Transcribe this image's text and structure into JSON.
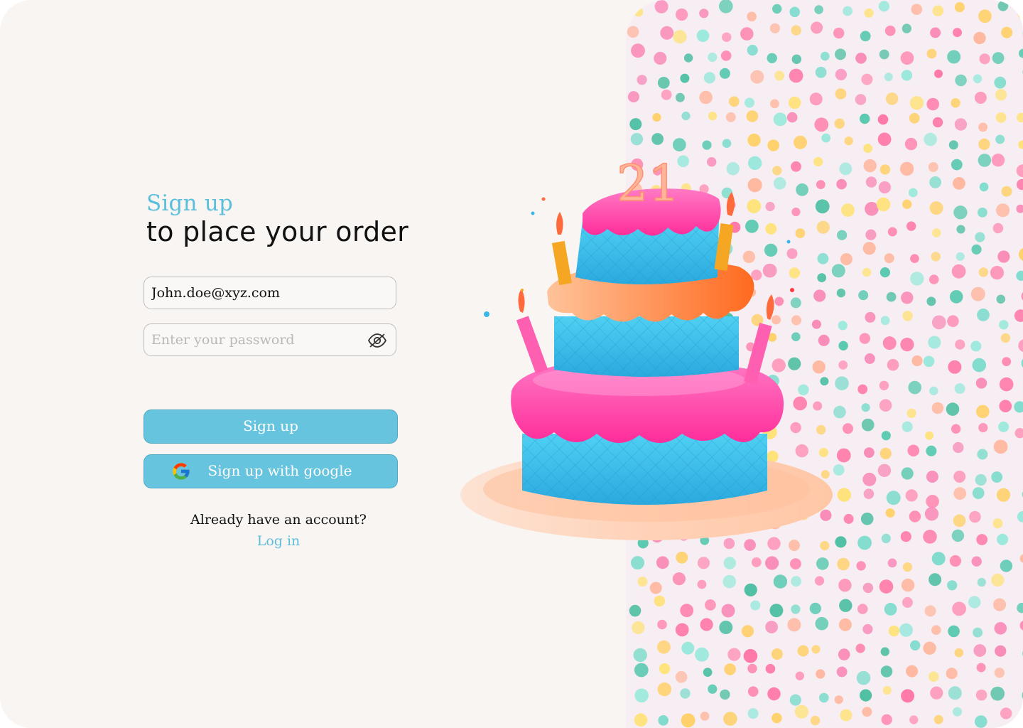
{
  "header": {
    "subtitle": "Sign up",
    "title": "to place your order"
  },
  "form": {
    "email_value": "John.doe@xyz.com",
    "password_placeholder": "Enter your password",
    "password_toggle_icon": "eye-off-icon",
    "signup_label": "Sign up",
    "google_label": "Sign up with google",
    "google_icon": "google-icon"
  },
  "footer": {
    "already_text": "Already have an account?",
    "login_label": "Log in"
  },
  "illustration": {
    "cake_number": "21"
  },
  "colors": {
    "accent": "#66c4de",
    "accent_text": "#5bbfdc",
    "page_bg": "#f9f5f3",
    "confetti_bg": "#f7eef3"
  }
}
